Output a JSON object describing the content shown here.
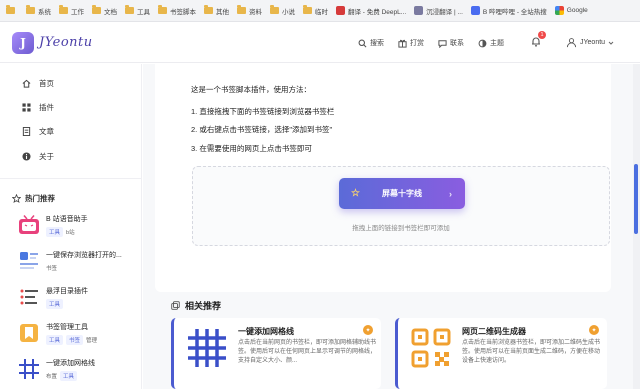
{
  "bookmarks": [
    {
      "label": "",
      "type": "folder"
    },
    {
      "label": "系统",
      "type": "folder"
    },
    {
      "label": "工作",
      "type": "folder"
    },
    {
      "label": "文档",
      "type": "folder"
    },
    {
      "label": "工具",
      "type": "folder"
    },
    {
      "label": "书签脚本",
      "type": "folder"
    },
    {
      "label": "其他",
      "type": "folder"
    },
    {
      "label": "资料",
      "type": "folder"
    },
    {
      "label": "小说",
      "type": "folder"
    },
    {
      "label": "临时",
      "type": "folder"
    },
    {
      "label": "翻译 - 免费 DeepL...",
      "type": "site",
      "color": "#d63a3a"
    },
    {
      "label": "沉浸翻译 | ...",
      "type": "site",
      "color": "#7a7aa0"
    },
    {
      "label": "B 哔哩哔哩 - 全站热搜",
      "type": "site",
      "color": "#4a6cf0"
    },
    {
      "label": "Google",
      "type": "site",
      "color": "#e0e0e0"
    }
  ],
  "header": {
    "logo_letter": "J",
    "logo_text": "JYeontu",
    "nav": [
      {
        "label": "搜索",
        "icon": "search-icon"
      },
      {
        "label": "打赏",
        "icon": "reward-icon"
      },
      {
        "label": "联系",
        "icon": "contact-icon"
      },
      {
        "label": "主题",
        "icon": "theme-icon"
      }
    ],
    "notification_count": "1",
    "user_name": "JYeontu"
  },
  "sidebar": {
    "menu": [
      {
        "label": "首页",
        "icon": "home-icon"
      },
      {
        "label": "插件",
        "icon": "grid-icon"
      },
      {
        "label": "文章",
        "icon": "article-icon"
      },
      {
        "label": "关于",
        "icon": "info-icon"
      }
    ],
    "hot_title": "热门推荐",
    "recommendations": [
      {
        "title": "B 站语音助手",
        "tags": [
          "工具",
          "b站"
        ]
      },
      {
        "title": "一键保存浏览器打开的...",
        "tags": [
          "书签"
        ]
      },
      {
        "title": "悬浮目录插件",
        "tags": [
          "工具"
        ]
      },
      {
        "title": "书签管理工具",
        "tags": [
          "工具",
          "书签",
          "管理"
        ]
      },
      {
        "title": "一键添加网格线",
        "tags": [
          "布置",
          "工具"
        ]
      }
    ]
  },
  "main": {
    "intro": "这是一个书签脚本插件，使用方法：",
    "steps": [
      "1. 直接拖拽下面的书签链接到浏览器书签栏",
      "2. 或右键点击书签链接，选择\"添加到书签\"",
      "3. 在需要使用的网页上点击书签即可"
    ],
    "bookmarklet_label": "屏幕十字线",
    "drop_hint": "拖拽上面的链接到书签栏即可添加",
    "related_title": "相关推荐",
    "related": [
      {
        "title": "一键添加网格线",
        "desc": "点击后在当前网页的书签栏，即可添加网格辅助线书签。使用后可以在任何网页上显示可调节的网格线，支持自定义大小、颜..."
      },
      {
        "title": "网页二维码生成器",
        "desc": "点击后在当前浏览器书签栏，即可添加二维码生成书签。使用后可以在当前页面生成二维码，方便在移动设备上快速访问。"
      }
    ]
  },
  "colors": {
    "accent": "#5b6bd8",
    "accent2": "#8a5de0",
    "badge": "#f04a4a",
    "pin": "#f0a030"
  }
}
